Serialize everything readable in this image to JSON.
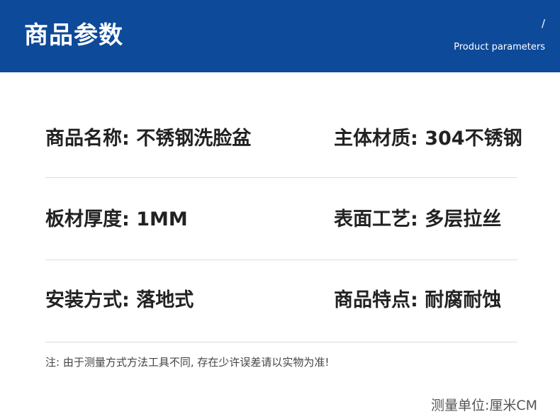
{
  "header": {
    "title": "商品参数",
    "slash": "/",
    "subtitle": "Product parameters"
  },
  "params": [
    {
      "left": {
        "label": "商品名称: ",
        "value": "不锈钢洗脸盆"
      },
      "right": {
        "label": "主体材质: ",
        "value": "304不锈钢"
      }
    },
    {
      "left": {
        "label": "板材厚度: ",
        "value": "1MM"
      },
      "right": {
        "label": "表面工艺: ",
        "value": "多层拉丝"
      }
    },
    {
      "left": {
        "label": "安装方式: ",
        "value": "落地式"
      },
      "right": {
        "label": "商品特点: ",
        "value": "耐腐耐蚀"
      }
    }
  ],
  "note": "注: 由于测量方式方法工具不同, 存在少许误差请以实物为准!",
  "unit_label": "测量单位:厘米CM",
  "colors": {
    "header_bg": "#0e4a9a",
    "text": "#222222",
    "divider": "#dcdcdc"
  }
}
